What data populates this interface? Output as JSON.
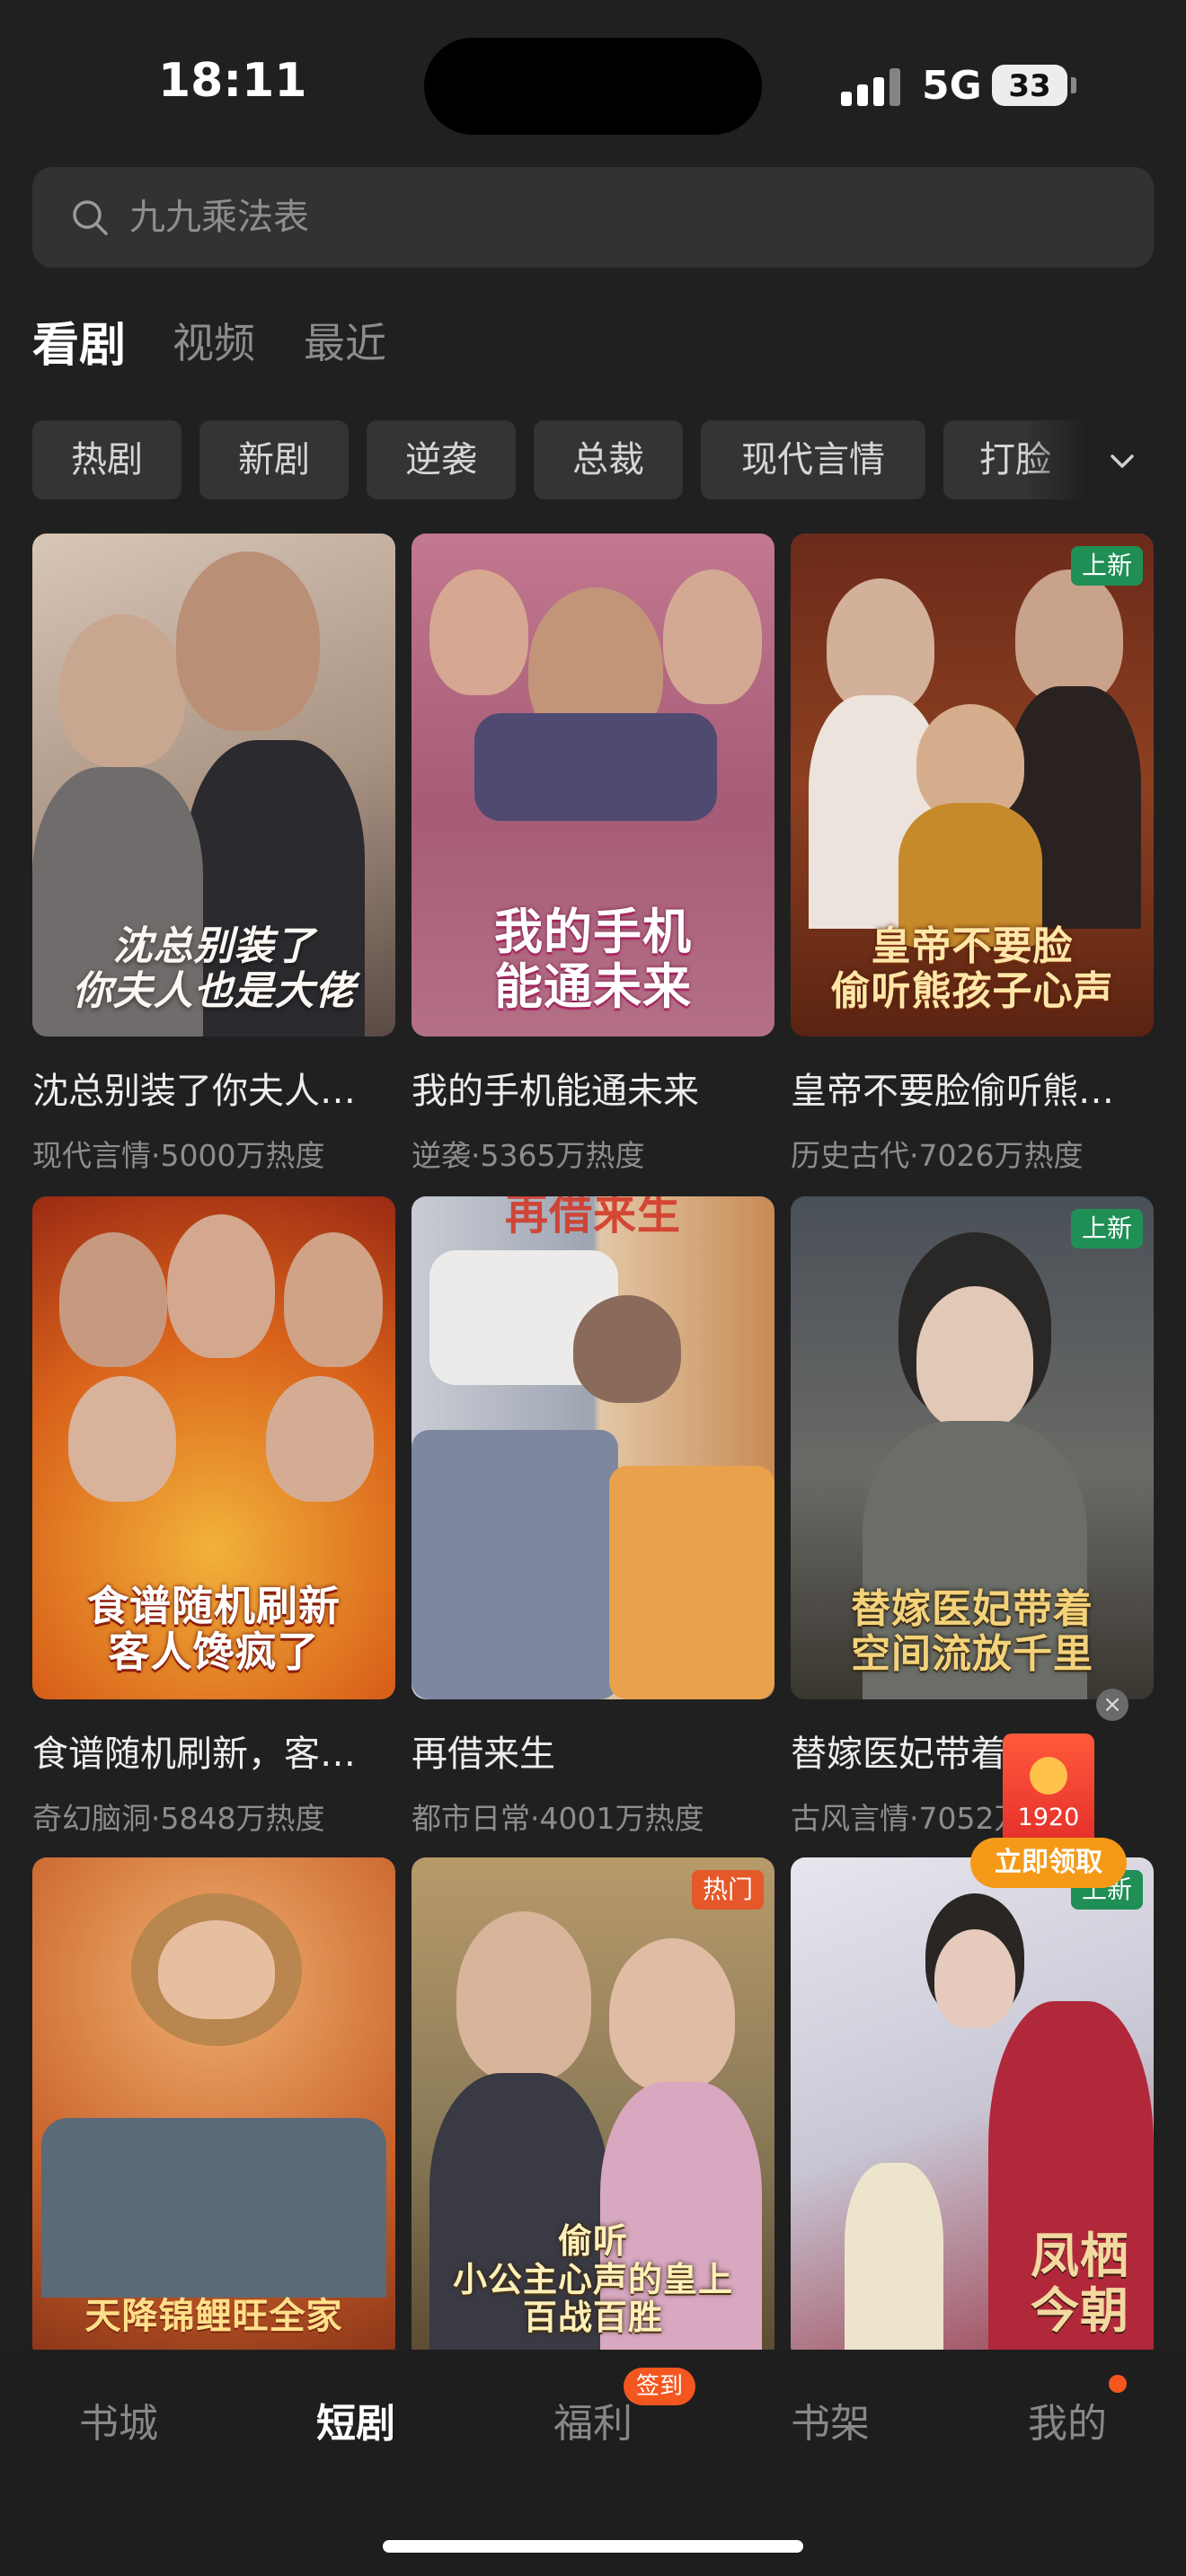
{
  "status": {
    "time": "18:11",
    "network": "5G",
    "battery": "33"
  },
  "search": {
    "placeholder": "九九乘法表"
  },
  "tabs": [
    {
      "label": "看剧"
    },
    {
      "label": "视频"
    },
    {
      "label": "最近"
    }
  ],
  "chips": [
    {
      "label": "热剧"
    },
    {
      "label": "新剧"
    },
    {
      "label": "逆袭"
    },
    {
      "label": "总裁"
    },
    {
      "label": "现代言情"
    },
    {
      "label": "打脸"
    }
  ],
  "dramas": [
    {
      "title": "沈总别装了你夫人…",
      "meta": "现代言情·5000万热度",
      "poster_text": "沈总别装了\n你夫人也是大佬",
      "badge": ""
    },
    {
      "title": "我的手机能通未来",
      "meta": "逆袭·5365万热度",
      "poster_text": "我的手机\n能通未来",
      "badge": ""
    },
    {
      "title": "皇帝不要脸偷听熊…",
      "meta": "历史古代·7026万热度",
      "poster_text": "皇帝不要脸\n偷听熊孩子心声",
      "badge": "上新"
    },
    {
      "title": "食谱随机刷新，客…",
      "meta": "奇幻脑洞·5848万热度",
      "poster_text": "食谱随机刷新\n客人馋疯了",
      "badge": ""
    },
    {
      "title": "再借来生",
      "meta": "都市日常·4001万热度",
      "poster_text": "再借来生",
      "badge": ""
    },
    {
      "title": "替嫁医妃带着…",
      "meta": "古风言情·7052万热度",
      "poster_text": "替嫁医妃带着\n空间流放千里",
      "badge": "上新"
    },
    {
      "title": "",
      "meta": "",
      "poster_text": "天降锦鲤旺全家",
      "badge": ""
    },
    {
      "title": "",
      "meta": "",
      "poster_text": "偷听\n小公主心声的皇上\n百战百胜",
      "badge": "热门"
    },
    {
      "title": "",
      "meta": "",
      "poster_text": "凤栖今朝",
      "badge": "上新"
    }
  ],
  "floating_reward": {
    "count": "1920",
    "button": "立即领取",
    "close": "×"
  },
  "bottom_nav": [
    {
      "label": "书城"
    },
    {
      "label": "短剧"
    },
    {
      "label": "福利"
    },
    {
      "label": "书架"
    },
    {
      "label": "我的"
    }
  ],
  "nav_badge": "签到",
  "colors": {
    "background": "#202021",
    "accent": "#f59a18",
    "badge_new": "#1f8f55",
    "badge_hot": "#e4582a"
  }
}
